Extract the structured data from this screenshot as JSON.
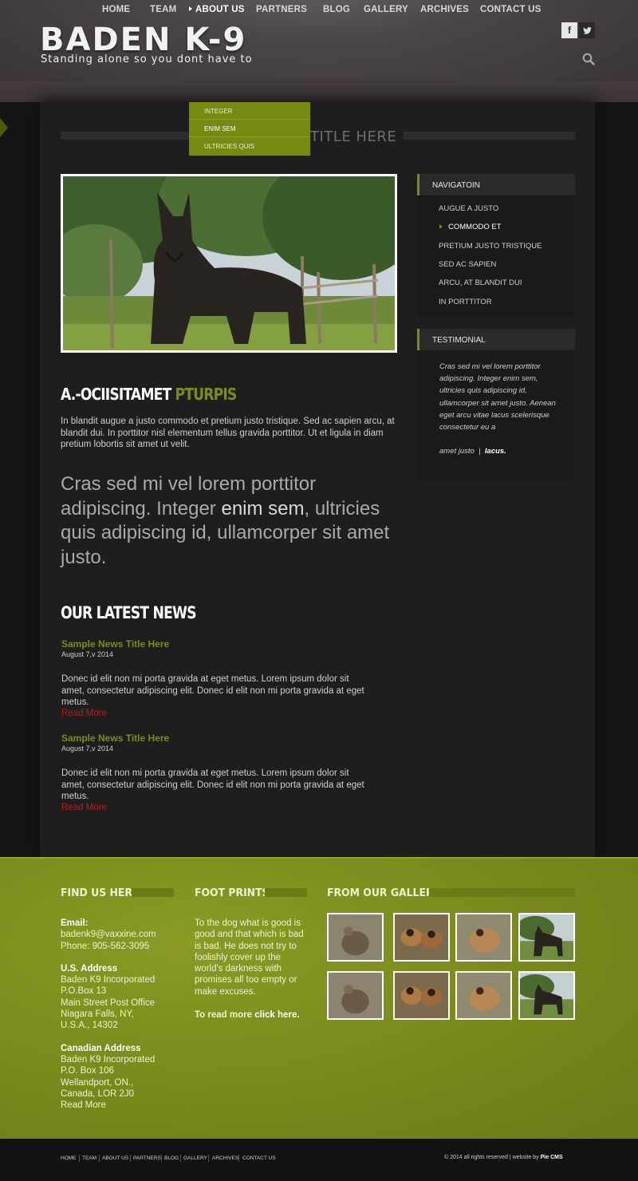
{
  "brand": {
    "logo": "BADEN K-9",
    "tagline": "Standing alone so you dont have to"
  },
  "social": {
    "facebook": "f",
    "twitter": "t"
  },
  "nav": {
    "items": [
      "HOME",
      "TEAM",
      "ABOUT US",
      "PARTNERS",
      "BLOG",
      "GALLERY",
      "ARCHIVES",
      "CONTACT US"
    ],
    "active": "ABOUT US"
  },
  "dropdown": {
    "items": [
      "INTEGER",
      "ENIM SEM",
      "ULTRICIES QUIS"
    ],
    "active": "ENIM SEM"
  },
  "page_title": "TITLE HERE",
  "article": {
    "heading_white": "A.-OCIISITAMET",
    "heading_green": "PTURPIS",
    "body": "In blandit augue a justo commodo et pretium justo tristique. Sed ac sapien arcu, at blandit dui. In porttitor nisl elementum tellus gravida porttitor. Ut et ligula in diam pretium lobortis sit amet ut velit.",
    "lead_before": "Cras sed mi vel lorem porttitor adipiscing. Integer ",
    "lead_bold": "enim sem",
    "lead_after": ", ultricies quis adipiscing id, ullamcorper sit amet justo."
  },
  "news": {
    "heading": "OUR LATEST NEWS",
    "items": [
      {
        "title": "Sample News Title Here",
        "date": "August 7,v 2014",
        "body": "Donec id elit non mi porta gravida at eget metus. Lorem ipsum dolor sit amet, consectetur adipiscing elit. Donec id elit non mi porta gravida at eget metus.",
        "more": "Read More"
      },
      {
        "title": "Sample News Title Here",
        "date": "August 7,v 2014",
        "body": "Donec id elit non mi porta gravida at eget metus. Lorem ipsum dolor sit amet, consectetur adipiscing elit. Donec id elit non mi porta gravida at eget metus.",
        "more": "Read More"
      }
    ]
  },
  "sidebar": {
    "nav_heading": "NAVIGATOIN",
    "links": [
      "AUGUE A JUSTO",
      "COMMODO ET",
      "PRETIUM JUSTO TRISTIQUE",
      "SED AC SAPIEN",
      "ARCU, AT BLANDIT DUI",
      "IN PORTTITOR"
    ],
    "active": "COMMODO ET",
    "testimonial_heading": "TESTIMONIAL",
    "testimonial": "Cras sed mi vel lorem porttitor adipiscing. Integer enim sem, ultricies quis adipiscing id, ullamcorper sit amet justo. Aenean eget arcu vitae lacus scelerisque consectetur eu a",
    "testimonial_author": "amet justo",
    "testimonial_sep": "|",
    "testimonial_source": "lacus."
  },
  "footer": {
    "find_heading": "FIND US HERE",
    "email_label": "Email:",
    "email": "badenk9@vaxxine.com",
    "phone": "Phone: 905-562-3095",
    "us_label": "U.S. Address",
    "us_lines": [
      "Baden K9 Incorporated",
      "P.O.Box 13",
      "Main Street Post Office",
      "Niagara Falls, NY,",
      "U.S.A., 14302"
    ],
    "ca_label": "Canadian Address",
    "ca_lines": [
      "Baden K9 Incorporated",
      "P.O. Box 106",
      "Wellandport, ON.,",
      "Canada, LOR 2J0"
    ],
    "ca_more": "Read More",
    "foot_heading": "FOOT PRINTS",
    "foot_text": "To the dog what is good is good and that which is bad is bad. He does not try to foolishly cover up the world's darkness with promises all too empty or make excuses.",
    "foot_more_prefix": "To read more",
    "foot_more_link": "click here.",
    "gallery_heading": "FROM OUR GALLERY"
  },
  "bottom": {
    "links": [
      "HOME",
      "TEAM",
      "ABOUT US",
      "PARTNERS",
      "BLOG",
      "GALLERY",
      "ARCHIVES",
      "CONTACT US"
    ],
    "copyright": "© 2014 all rights reserved",
    "sep": "|",
    "credit_prefix": "website by",
    "credit": "Pie CMS"
  },
  "colors": {
    "accent": "#7a8f12",
    "link_red": "#b51e1e",
    "footer_green": "#7a8a1c",
    "dark": "#1e1e1e"
  }
}
